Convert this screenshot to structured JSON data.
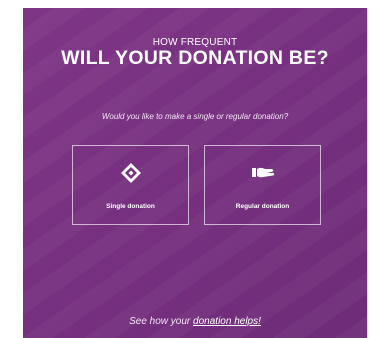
{
  "header": {
    "eyebrow": "HOW FREQUENT",
    "title": "WILL YOUR DONATION BE?"
  },
  "prompt": {
    "question": "Would you like to make a single or regular donation?"
  },
  "options": [
    {
      "label": "Single donation",
      "icon": "diamond-shield-icon"
    },
    {
      "label": "Regular donation",
      "icon": "giving-hand-icon"
    }
  ],
  "footer": {
    "prefix": "See how your ",
    "link": "donation helps!"
  },
  "colors": {
    "panel": "#773080",
    "text": "#ffffff"
  }
}
